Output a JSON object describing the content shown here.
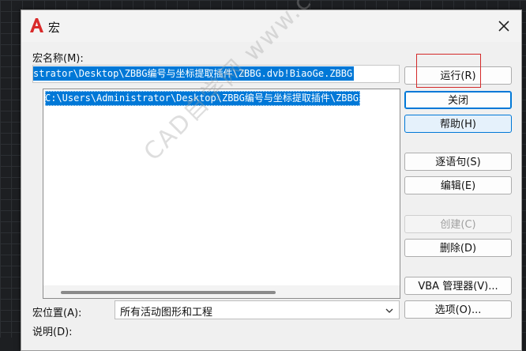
{
  "dialog": {
    "title": "宏",
    "logo_icon": "autocad-logo-icon",
    "close_icon": "close-icon"
  },
  "macro_name": {
    "label": "宏名称(M):",
    "value": "strator\\Desktop\\ZBBG编号与坐标提取插件\\ZBBG.dvb!BiaoGe.ZBBG"
  },
  "macro_list": {
    "items": [
      "C:\\Users\\Administrator\\Desktop\\ZBBG编号与坐标提取插件\\ZBBG"
    ]
  },
  "buttons": {
    "run": "运行(R)",
    "close": "关闭",
    "help": "帮助(H)",
    "step_into": "逐语句(S)",
    "edit": "编辑(E)",
    "create": "创建(C)",
    "delete": "删除(D)",
    "vba_manager": "VBA 管理器(V)...",
    "options": "选项(O)..."
  },
  "macro_location": {
    "label": "宏位置(A):",
    "selected": "所有活动图形和工程",
    "arrow_icon": "chevron-down-icon"
  },
  "description": {
    "label": "说明(D):"
  },
  "watermark": {
    "text": "CAD自学网  www.cadzxw.com"
  },
  "colors": {
    "selection": "#0078d7",
    "highlight_box": "#d42a2a",
    "logo_red": "#d92b2b"
  }
}
